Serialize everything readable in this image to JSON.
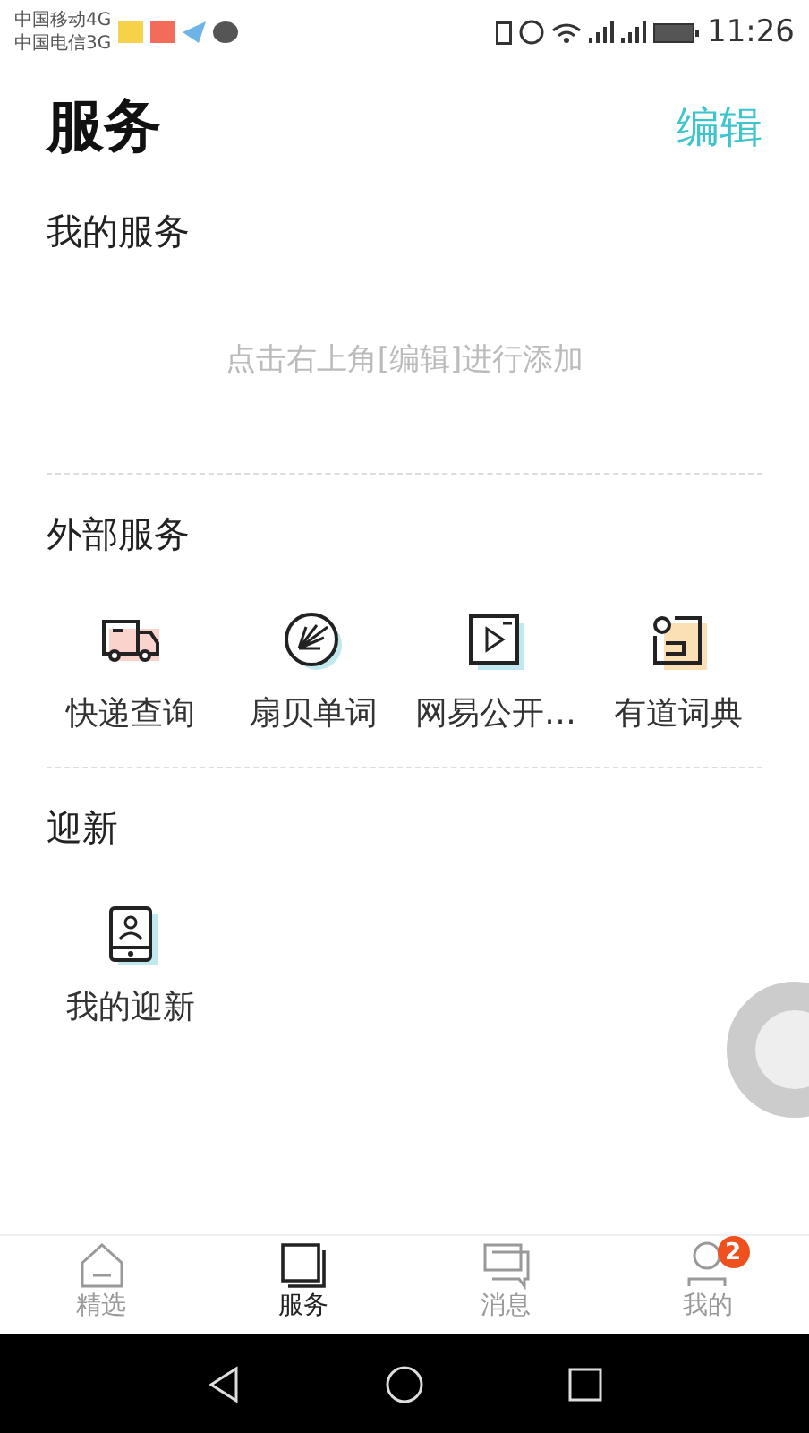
{
  "status_bar": {
    "carriers": [
      "中国移动4G",
      "中国电信3G"
    ],
    "time": "11:26"
  },
  "header": {
    "title": "服务",
    "edit": "编辑"
  },
  "sections": [
    {
      "title": "我的服务",
      "empty_hint": "点击右上角[编辑]进行添加"
    },
    {
      "title": "外部服务",
      "items": [
        {
          "label": "快递查询",
          "kind": "truck"
        },
        {
          "label": "扇贝单词",
          "kind": "shell"
        },
        {
          "label": "网易公开…",
          "kind": "video"
        },
        {
          "label": "有道词典",
          "kind": "dict"
        }
      ]
    },
    {
      "title": "迎新",
      "items": [
        {
          "label": "我的迎新",
          "kind": "phone"
        }
      ]
    }
  ],
  "tabs": [
    {
      "label": "精选",
      "kind": "home",
      "selected": false
    },
    {
      "label": "服务",
      "kind": "service",
      "selected": true
    },
    {
      "label": "消息",
      "kind": "message",
      "selected": false
    },
    {
      "label": "我的",
      "kind": "me",
      "selected": false,
      "badge": "2"
    }
  ]
}
